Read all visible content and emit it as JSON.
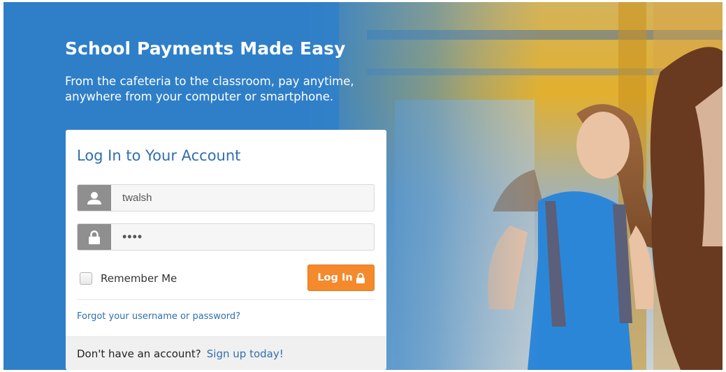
{
  "hero": {
    "title": "School Payments Made Easy",
    "subtitle": "From the cafeteria to the classroom, pay anytime, anywhere from your computer or smartphone."
  },
  "login": {
    "title": "Log In to Your Account",
    "username": {
      "value": "twalsh",
      "icon": "user-icon"
    },
    "password": {
      "value": "••••",
      "icon": "lock-icon"
    },
    "remember_label": "Remember Me",
    "remember_checked": false,
    "submit_label": "Log In",
    "submit_icon": "lock-icon",
    "forgot_link": "Forgot your username or password?"
  },
  "footer": {
    "prompt": "Don't have an account?",
    "signup_link": "Sign up today!"
  },
  "colors": {
    "brand_blue": "#2f7fc8",
    "link_blue": "#2f6fae",
    "button_orange": "#f48a2c",
    "icon_gray": "#8f8f8f"
  }
}
